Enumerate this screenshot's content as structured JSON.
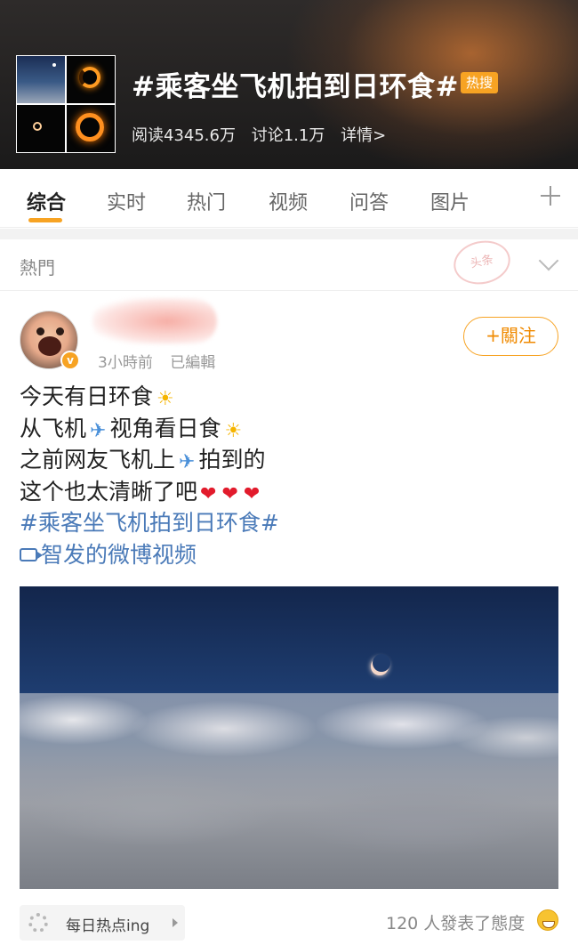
{
  "header": {
    "title": "#乘客坐飞机拍到日环食#",
    "badge": "热搜",
    "reads": "阅读4345.6万",
    "discussions": "讨论1.1万",
    "details": "详情>"
  },
  "tabs": [
    "综合",
    "实时",
    "热门",
    "视频",
    "问答",
    "图片"
  ],
  "section": {
    "label": "熱門",
    "stamp": "头条"
  },
  "post": {
    "time": "3小時前",
    "edited": "已編輯",
    "follow_label": "+關注",
    "verified_mark": "v",
    "lines": {
      "l1": "今天有日环食",
      "l2a": "从飞机",
      "l2b": "视角看日食",
      "l3a": "之前网友飞机上",
      "l3b": "拍到的",
      "l4": "这个也太清晰了吧",
      "hashtag": "#乘客坐飞机拍到日环食#",
      "video": "智发的微博视频"
    },
    "emoji": {
      "sun": "☀",
      "plane": "✈",
      "heart": "❤"
    }
  },
  "footer": {
    "source": "每日热点ing",
    "reactions": "120 人發表了態度"
  },
  "colors": {
    "accent": "#f7a323",
    "link": "#4a7ab8"
  }
}
